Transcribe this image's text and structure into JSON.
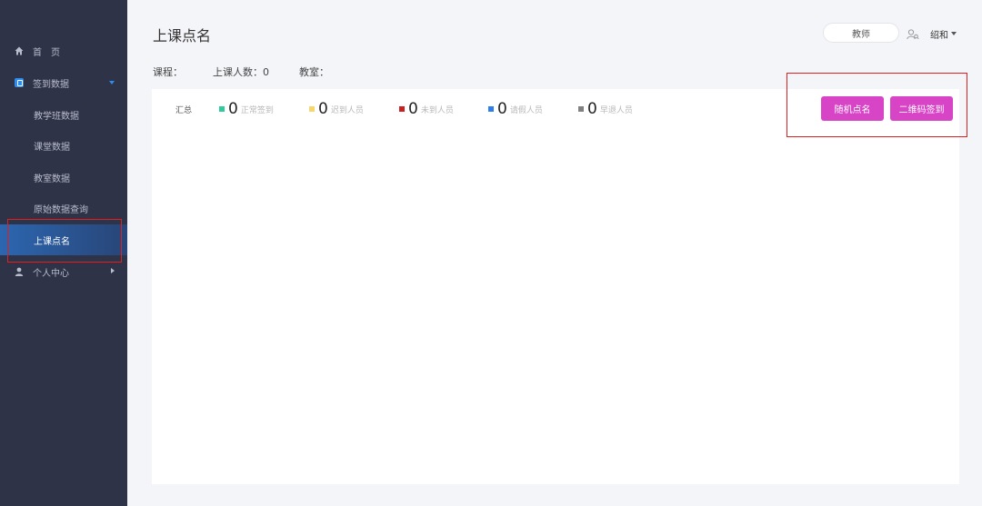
{
  "sidebar": {
    "items": [
      {
        "label": "首　页",
        "icon": "house-icon"
      },
      {
        "label": "签到数据",
        "icon": "data-icon"
      },
      {
        "label": "教学班数据"
      },
      {
        "label": "课堂数据"
      },
      {
        "label": "教室数据"
      },
      {
        "label": "原始数据查询"
      },
      {
        "label": "上课点名"
      },
      {
        "label": "个人中心",
        "icon": "person-icon"
      }
    ]
  },
  "header": {
    "title": "上课点名",
    "role": "教师",
    "user": "绍和"
  },
  "info": {
    "course": "课程：",
    "count": "上课人数：0",
    "room": "教室："
  },
  "summary": {
    "label": "汇总",
    "stats": [
      {
        "value": "0",
        "label": "正常签到",
        "color": "#2ecc9a"
      },
      {
        "value": "0",
        "label": "迟到人员",
        "color": "#f5d76e"
      },
      {
        "value": "0",
        "label": "未到人员",
        "color": "#cc1f1f"
      },
      {
        "value": "0",
        "label": "请假人员",
        "color": "#2d7ff0"
      },
      {
        "value": "0",
        "label": "早退人员",
        "color": "#808080"
      }
    ]
  },
  "actions": {
    "random": "随机点名",
    "qrcode": "二维码签到"
  },
  "colors": {
    "sidebar": "#2f3348",
    "active": "#2c66b0",
    "button": "#d844c6",
    "highlight": "#e02020"
  }
}
